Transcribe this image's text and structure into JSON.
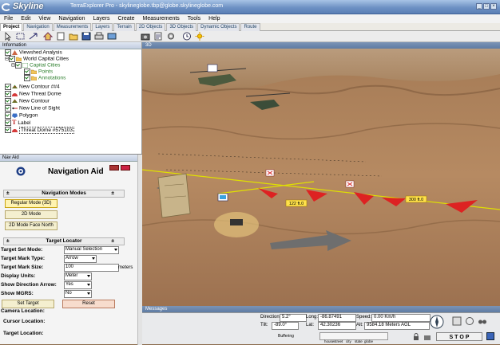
{
  "window": {
    "logo": "Skyline",
    "title": "TerraExplorer Pro - skylineglobe.tbp@globe.skylineglobe.com"
  },
  "menu": [
    "File",
    "Edit",
    "View",
    "Navigation",
    "Layers",
    "Create",
    "Measurements",
    "Tools",
    "Help"
  ],
  "tabs": [
    "Project",
    "Navigation",
    "Measurements",
    "Layers",
    "Terrain",
    "2D Objects",
    "3D Objects",
    "Dynamic Objects",
    "Route"
  ],
  "information": {
    "header": "Information",
    "items": [
      {
        "label": "Viewshed Analysis"
      },
      {
        "label": "World Capital Cities"
      },
      {
        "label": "Capital Cities"
      },
      {
        "label": "Points"
      },
      {
        "label": "Annotations"
      },
      {
        "label": "New Contour ##4"
      },
      {
        "label": "New Threat Dome"
      },
      {
        "label": "New Contour"
      },
      {
        "label": "New Line of Sight"
      },
      {
        "label": "Polygon"
      },
      {
        "label": "Label"
      },
      {
        "label": "Threat Dome #575103"
      }
    ]
  },
  "nav_aid": {
    "window_label": "Nav Aid",
    "title": "Navigation Aid",
    "modes_header": "Navigation Modes",
    "modes": [
      "Regular Mode (3D)",
      "2D Mode",
      "2D Mode Face North"
    ],
    "locator_header": "Target Locator",
    "fields": [
      {
        "label": "Target Set Mode:",
        "value": "Manual Selection"
      },
      {
        "label": "Target Mark Type:",
        "value": "Arrow"
      },
      {
        "label": "Target Mark Size:",
        "value": "100",
        "unit": "meters"
      },
      {
        "label": "Display Units:",
        "value": "Meter"
      },
      {
        "label": "Show Direction Arrow:",
        "value": "Yes"
      },
      {
        "label": "Show MGRS:",
        "value": "No"
      }
    ],
    "set_target": "Set Target",
    "reset": "Reset",
    "camera_location": "Camera Location:",
    "cursor_location": "Cursor Location:",
    "target_location": "Target Location:"
  },
  "viewport": {
    "label": "3D",
    "annotations": [
      "122 ft.0",
      "300 ft.0"
    ]
  },
  "messages": {
    "label": "Messages"
  },
  "status": {
    "direction_label": "Direction:",
    "direction_value": "5.2°",
    "tilt_label": "Tilt:",
    "tilt_value": "-89.0°",
    "long_label": "Long:",
    "long_value": "-86.87491",
    "lat_label": "Lat:",
    "lat_value": "42.30236",
    "speed_label": "Speed:",
    "speed_value": "0.00 Km/h",
    "alt_label": "Alt:",
    "alt_value": "9584.18 Meters AGL",
    "buffering": "Buffering",
    "zoom_levels": [
      "house",
      "street",
      "city",
      "state",
      "globe"
    ],
    "stop": "S T O P"
  }
}
